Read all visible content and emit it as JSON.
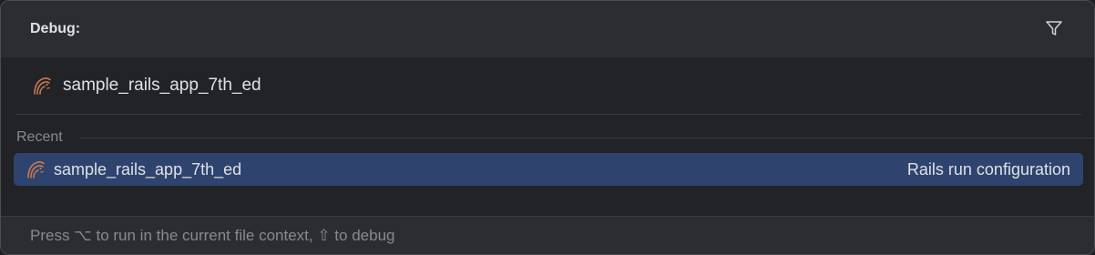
{
  "header": {
    "title": "Debug:",
    "filter_icon": "filter-icon"
  },
  "search": {
    "value": "sample_rails_app_7th_ed",
    "icon": "rails-icon"
  },
  "section": {
    "label": "Recent"
  },
  "items": [
    {
      "label": "sample_rails_app_7th_ed",
      "type": "Rails run configuration",
      "icon": "rails-icon",
      "selected": true
    }
  ],
  "footer": {
    "hint": "Press ⌥ to run in the current file context, ⇧ to debug"
  },
  "colors": {
    "background": "#2b2d30",
    "list_background": "#222326",
    "selection": "#2e436e",
    "text": "#dfe1e5",
    "muted_text": "#868a91",
    "rails_icon": "#c67a50"
  }
}
